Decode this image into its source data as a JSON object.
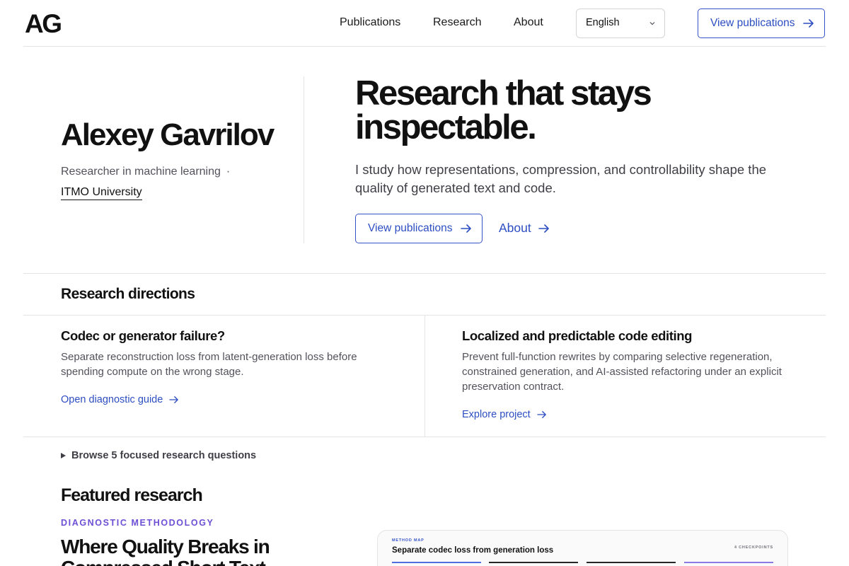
{
  "header": {
    "logo": "AG",
    "nav": [
      "Publications",
      "Research",
      "About"
    ],
    "language": "English",
    "cta": "View publications"
  },
  "hero": {
    "name": "Alexey Gavrilov",
    "role": "Researcher in machine learning",
    "separator": "·",
    "university": "ITMO University",
    "headline": "Research that stays inspectable.",
    "lede": "I study how representations, compression, and controllability shape the quality of generated text and code.",
    "primary_cta": "View publications",
    "secondary_cta": "About"
  },
  "directions": {
    "heading": "Research directions",
    "cards": [
      {
        "title": "Codec or generator failure?",
        "body": "Separate reconstruction loss from latent-generation loss before spending compute on the wrong stage.",
        "link": "Open diagnostic guide"
      },
      {
        "title": "Localized and predictable code editing",
        "body": "Prevent full-function rewrites by comparing selective regeneration, constrained generation, and AI-assisted refactoring under an explicit preservation contract.",
        "link": "Explore project"
      }
    ],
    "browse": "Browse 5 focused research questions"
  },
  "featured": {
    "heading": "Featured research",
    "eyebrow": "DIAGNOSTIC METHODOLOGY",
    "title": "Where Quality Breaks in Compressed Short Text",
    "method_map": {
      "eyebrow": "METHOD MAP",
      "title": "Separate codec loss from generation loss",
      "count": "4 CHECKPOINTS",
      "bar_colors": [
        "#4f6fe0",
        "#27272a",
        "#27272a",
        "#8b7ae6"
      ]
    }
  },
  "colors": {
    "accent": "#2d4ec2",
    "eyebrow": "#6d4fd6",
    "text": "#111111",
    "muted": "#52525b",
    "rule": "#e4e4e7"
  }
}
